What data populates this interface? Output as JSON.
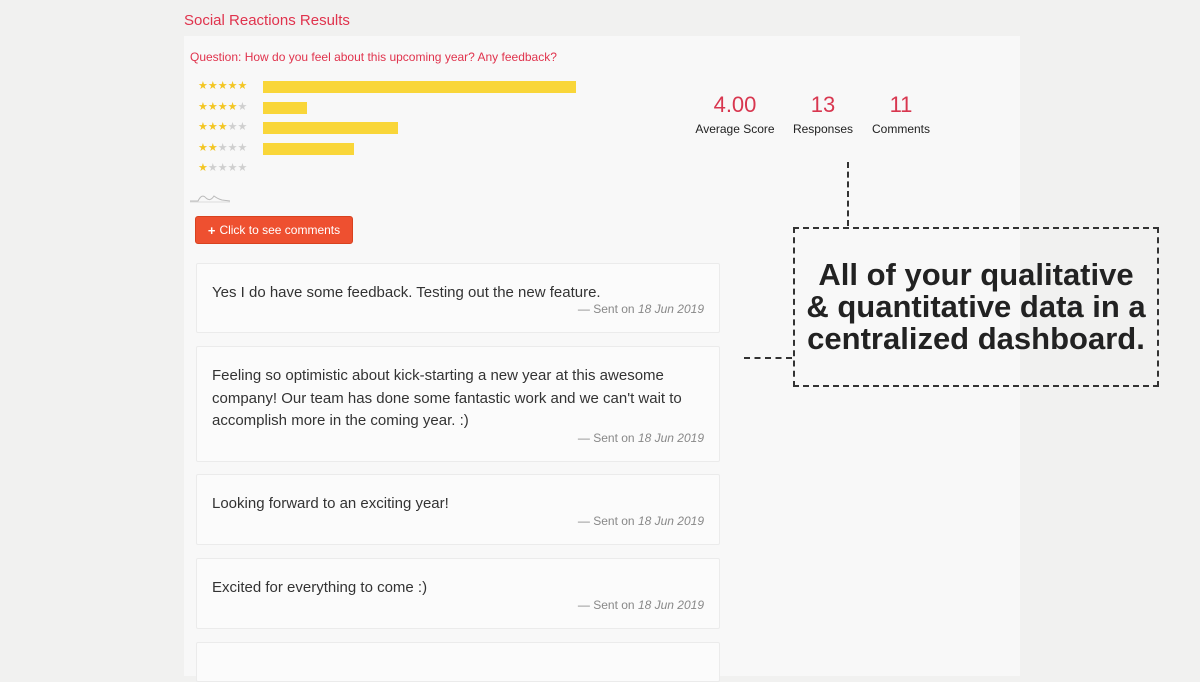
{
  "page": {
    "title": "Social Reactions Results"
  },
  "question": {
    "text": "Question: How do you feel about this upcoming year? Any feedback?"
  },
  "ratings": [
    {
      "stars": 5,
      "share": 1.0
    },
    {
      "stars": 4,
      "share": 0.14
    },
    {
      "stars": 3,
      "share": 0.43
    },
    {
      "stars": 2,
      "share": 0.29
    },
    {
      "stars": 1,
      "share": 0.0
    }
  ],
  "action": {
    "label": "Click to see comments",
    "icon": "plus-icon"
  },
  "stats": {
    "average": {
      "value": "4.00",
      "label": "Average Score"
    },
    "responses": {
      "value": "13",
      "label": "Responses"
    },
    "comments": {
      "value": "11",
      "label": "Comments"
    }
  },
  "comments": [
    {
      "text": "Yes I do have some feedback. Testing out the new feature.",
      "sent_prefix": "— Sent on",
      "date": "18 Jun 2019"
    },
    {
      "text": "Feeling so optimistic about kick-starting a new year at this awesome company! Our team has done some fantastic work and we can't wait to accomplish more in the coming year. :)",
      "sent_prefix": "— Sent on",
      "date": "18 Jun 2019"
    },
    {
      "text": "Looking forward to an exciting year!",
      "sent_prefix": "— Sent on",
      "date": "18 Jun 2019"
    },
    {
      "text": "Excited for everything to come :)",
      "sent_prefix": "— Sent on",
      "date": "18 Jun 2019"
    }
  ],
  "callout": {
    "text": "All of your qualitative & quantitative data in a centralized dashboard."
  },
  "colors": {
    "accent": "#e0334d",
    "bar": "#f9d639",
    "star": "#f3c623",
    "button": "#ee5030"
  }
}
